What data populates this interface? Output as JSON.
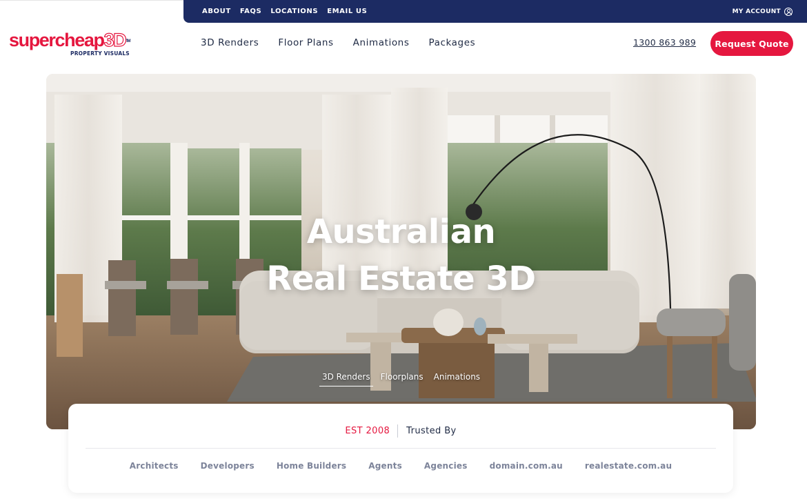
{
  "utility_nav": {
    "items": [
      "ABOUT",
      "FAQS",
      "LOCATIONS",
      "EMAIL US"
    ],
    "account_label": "MY ACCOUNT",
    "background": "#1c2b63"
  },
  "brand": {
    "name_part1": "supercheap",
    "name_part2": "3D",
    "trademark": "TM",
    "subtitle": "PROPERTY VISUALS",
    "accent_color": "#e5173f"
  },
  "main_nav": {
    "items": [
      "3D Renders",
      "Floor Plans",
      "Animations",
      "Packages"
    ]
  },
  "contact": {
    "phone": "1300 863 989",
    "cta_label": "Request Quote"
  },
  "hero": {
    "title_line1": "Australian",
    "title_line2": "Real Estate 3D",
    "tabs": [
      "3D Renders",
      "Floorplans",
      "Animations"
    ],
    "active_tab": "3D Renders"
  },
  "trust": {
    "est": "EST 2008",
    "label": "Trusted By",
    "clients": [
      "Architects",
      "Developers",
      "Home Builders",
      "Agents",
      "Agencies",
      "domain.com.au",
      "realestate.com.au"
    ]
  }
}
